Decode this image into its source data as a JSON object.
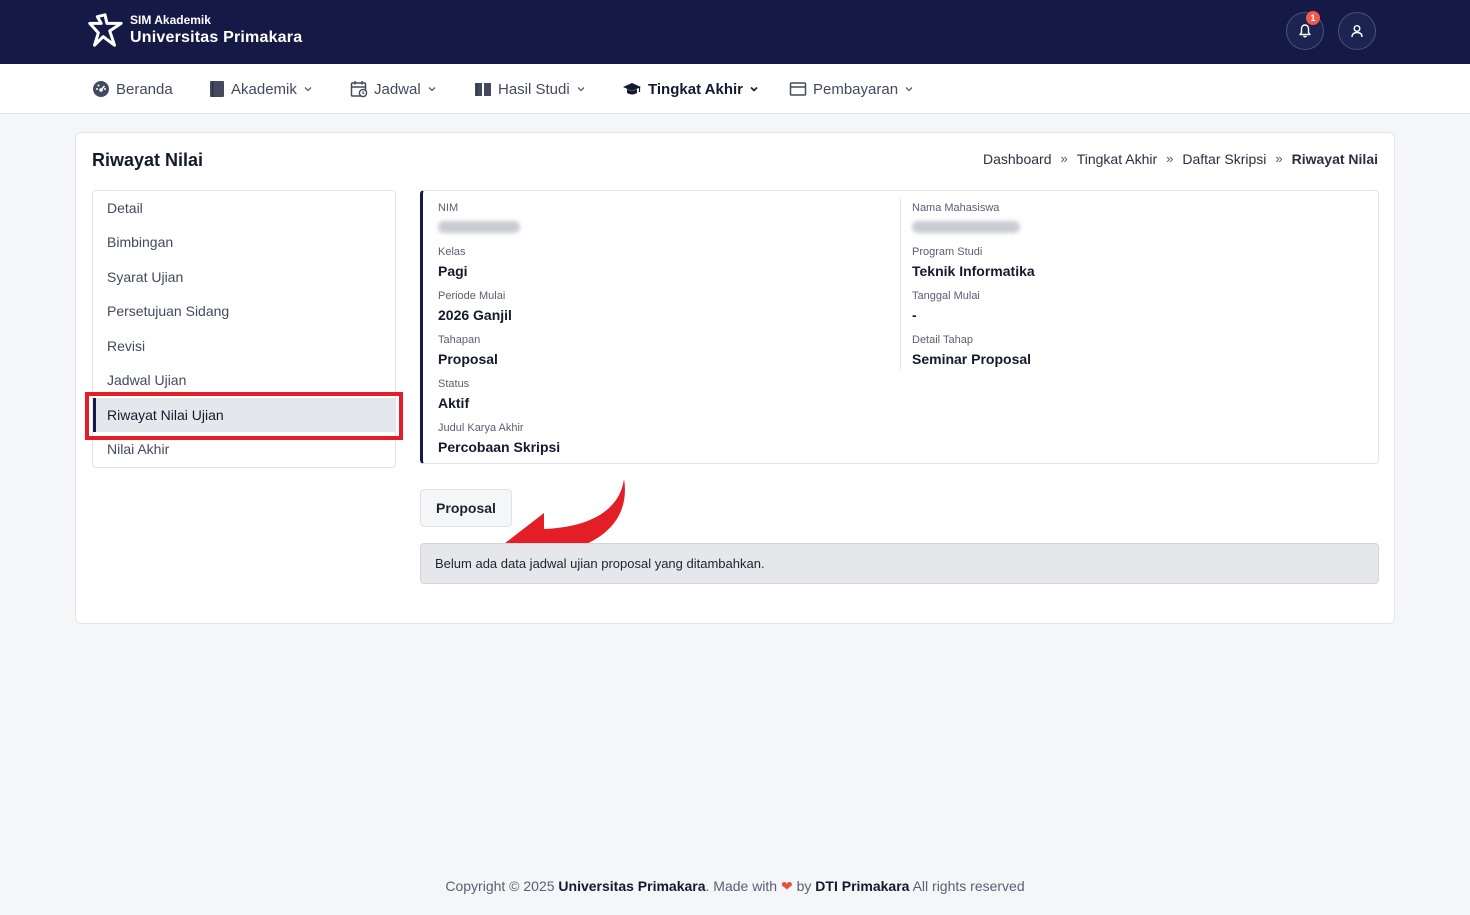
{
  "brand": {
    "small": "SIM Akademik",
    "big": "Universitas Primakara"
  },
  "header": {
    "notification_count": "1"
  },
  "nav": [
    {
      "label": "Beranda",
      "icon": "dashboard-gauge-icon"
    },
    {
      "label": "Akademik",
      "icon": "book-icon"
    },
    {
      "label": "Jadwal",
      "icon": "calendar-icon"
    },
    {
      "label": "Hasil Studi",
      "icon": "open-book-icon"
    },
    {
      "label": "Tingkat Akhir",
      "icon": "graduation-cap-icon",
      "active": true
    },
    {
      "label": "Pembayaran",
      "icon": "wallet-icon"
    }
  ],
  "page": {
    "title": "Riwayat Nilai"
  },
  "breadcrumb": [
    "Dashboard",
    "Tingkat Akhir",
    "Daftar Skripsi",
    "Riwayat Nilai"
  ],
  "sidemenu": [
    "Detail",
    "Bimbingan",
    "Syarat Ujian",
    "Persetujuan Sidang",
    "Revisi",
    "Jadwal Ujian",
    "Riwayat Nilai Ujian",
    "Nilai Akhir"
  ],
  "sidemenu_active": "Riwayat Nilai Ujian",
  "info": {
    "nim_label": "NIM",
    "nama_label": "Nama Mahasiswa",
    "kelas_label": "Kelas",
    "kelas_value": "Pagi",
    "prodi_label": "Program Studi",
    "prodi_value": "Teknik Informatika",
    "periode_label": "Periode Mulai",
    "periode_value": "2026 Ganjil",
    "tanggal_label": "Tanggal Mulai",
    "tanggal_value": "-",
    "tahapan_label": "Tahapan",
    "tahapan_value": "Proposal",
    "detail_tahap_label": "Detail Tahap",
    "detail_tahap_value": "Seminar Proposal",
    "status_label": "Status",
    "status_value": "Aktif",
    "karya_label": "Judul Karya Akhir",
    "karya_value": "Percobaan Skripsi"
  },
  "tab": {
    "label": "Proposal"
  },
  "alert": {
    "text": "Belum ada data jadwal ujian proposal yang ditambahkan."
  },
  "footer": {
    "prefix": "Copyright © 2025 ",
    "org": "Universitas Primakara",
    "made_with": ". Made with ",
    "by": " by ",
    "team": "DTI Primakara",
    "suffix": " All rights reserved"
  },
  "colors": {
    "header_bg": "#141a45",
    "highlight": "#e41e26",
    "heart": "#e5533d"
  }
}
